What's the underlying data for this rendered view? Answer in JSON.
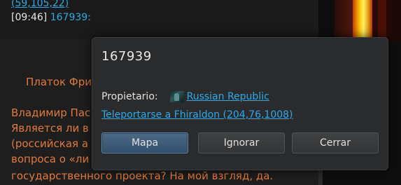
{
  "chat": {
    "top_link": "(59,105,22)",
    "time": "[09:46]",
    "name": "167939:",
    "orange_line": "Платок Фри",
    "lines": [
      "Владимир Пас",
      "Является ли в",
      "(российская а",
      "вопроса о «ли",
      "государственного проекта? На мой взгляд, да."
    ]
  },
  "dialog": {
    "title": "167939",
    "owner_label": "Propietario:",
    "owner_name": "Russian Republic",
    "teleport_text": "Teleportarse a Fhiraldon (204,76,1008)",
    "buttons": {
      "map": "Mapa",
      "ignore": "Ignorar",
      "close": "Cerrar"
    }
  },
  "colors": {
    "link": "#2fa9e8",
    "orange_text": "#e07a3e",
    "dialog_bg": "#2a2b2c",
    "primary_button": "#3d5b78"
  }
}
